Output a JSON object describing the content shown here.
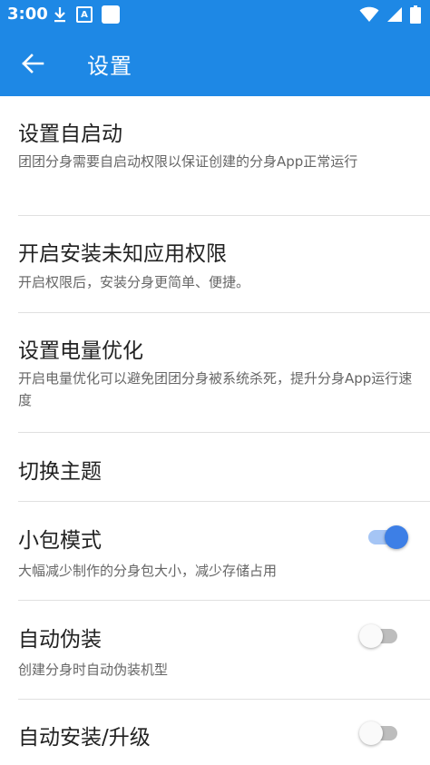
{
  "statusbar": {
    "time": "3:00",
    "app_badge": "A"
  },
  "appbar": {
    "title": "设置",
    "back_icon": "arrow-left-icon"
  },
  "colors": {
    "primary": "#1e88e5",
    "switch_on": "#3d7fe6"
  },
  "settings": [
    {
      "title": "设置自启动",
      "desc": "团团分身需要自启动权限以保证创建的分身App正常运行"
    },
    {
      "title": "开启安装未知应用权限",
      "desc": "开启权限后，安装分身更简单、便捷。"
    },
    {
      "title": "设置电量优化",
      "desc": "开启电量优化可以避免团团分身被系统杀死，提升分身App运行速度"
    },
    {
      "title": "切换主题"
    },
    {
      "title": "小包模式",
      "desc": "大幅减少制作的分身包大小，减少存储占用",
      "toggle": true
    },
    {
      "title": "自动伪装",
      "desc": "创建分身时自动伪装机型",
      "toggle": false
    },
    {
      "title": "自动安装/升级",
      "toggle": false
    }
  ]
}
